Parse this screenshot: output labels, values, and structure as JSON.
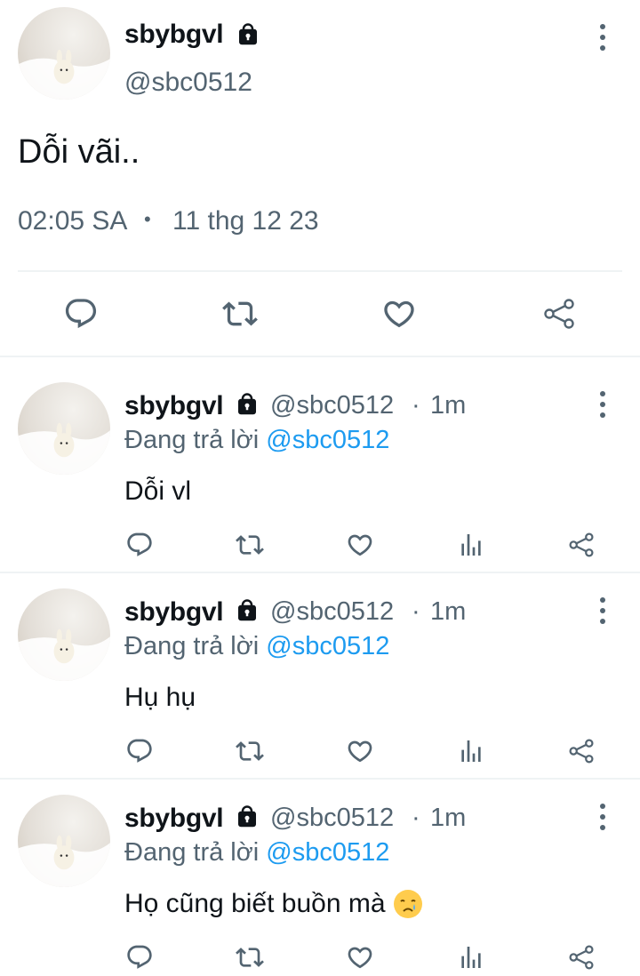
{
  "main_tweet": {
    "display_name": "sbybgvl",
    "handle": "@sbc0512",
    "text": "Dỗi vãi..",
    "time": "02:05 SA",
    "separator": "•",
    "date": "11 thg 12 23"
  },
  "reply_prefix": "Đang trả lời",
  "replies": [
    {
      "display_name": "sbybgvl",
      "handle": "@sbc0512",
      "dot": "·",
      "age": "1m",
      "reply_to": "@sbc0512",
      "text": "Dỗi vl"
    },
    {
      "display_name": "sbybgvl",
      "handle": "@sbc0512",
      "dot": "·",
      "age": "1m",
      "reply_to": "@sbc0512",
      "text": "Hụ hụ"
    },
    {
      "display_name": "sbybgvl",
      "handle": "@sbc0512",
      "dot": "·",
      "age": "1m",
      "reply_to": "@sbc0512",
      "text": "Họ cũng biết buồn mà"
    }
  ],
  "icons": {
    "lock": "lock-icon",
    "more": "kebab-icon",
    "reply": "reply-icon",
    "retweet": "retweet-icon",
    "like": "heart-icon",
    "views": "analytics-icon",
    "share": "share-icon",
    "emoji": "crying-face-icon"
  },
  "colors": {
    "text": "#0f1419",
    "muted": "#536471",
    "link": "#1d9bf0",
    "divider": "#eff3f4"
  }
}
